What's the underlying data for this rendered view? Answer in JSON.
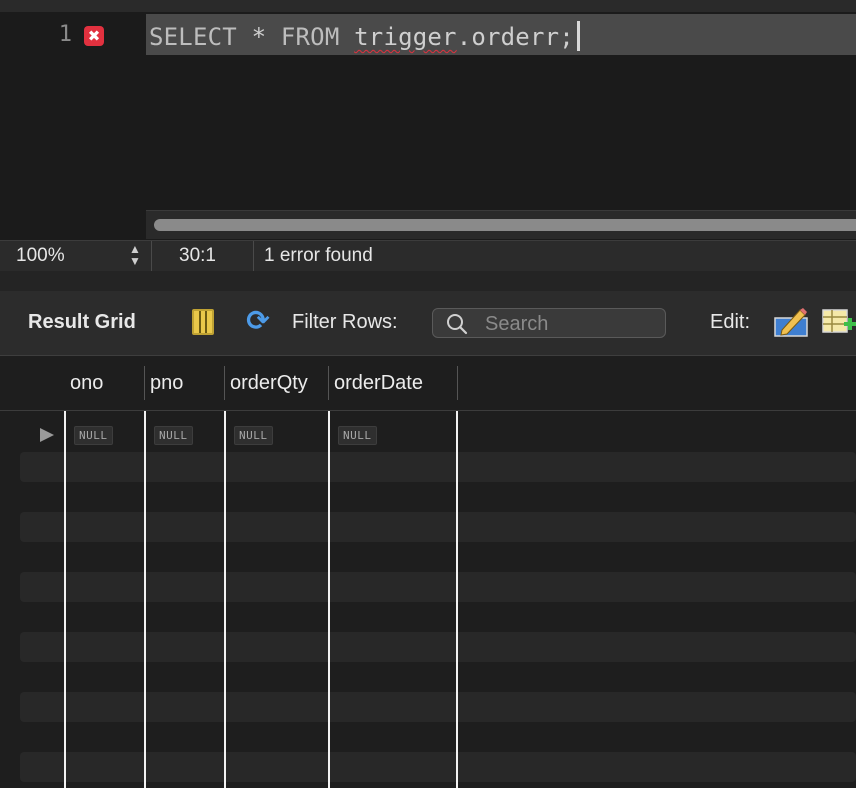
{
  "editor": {
    "line_number": "1",
    "code": {
      "kw_select": "SELECT",
      "star": "*",
      "kw_from": "FROM",
      "schema": "trigger",
      "dot": ".",
      "table": "orderr",
      "semicolon": ";"
    },
    "error_marker": "✖"
  },
  "status_bar": {
    "zoom": "100%",
    "cursor": "30:1",
    "message": "1 error found"
  },
  "toolbar": {
    "title": "Result Grid",
    "filter_label": "Filter Rows:",
    "search_placeholder": "Search",
    "edit_label": "Edit:",
    "icons": [
      "grid-layout-icon",
      "refresh-icon",
      "search-icon",
      "edit-pencil-icon",
      "add-row-icon"
    ]
  },
  "grid": {
    "columns": [
      "ono",
      "pno",
      "orderQty",
      "orderDate"
    ],
    "rows": [
      [
        "NULL",
        "NULL",
        "NULL",
        "NULL"
      ]
    ]
  },
  "colors": {
    "error": "#e2313f",
    "accent": "#4d9be8"
  }
}
